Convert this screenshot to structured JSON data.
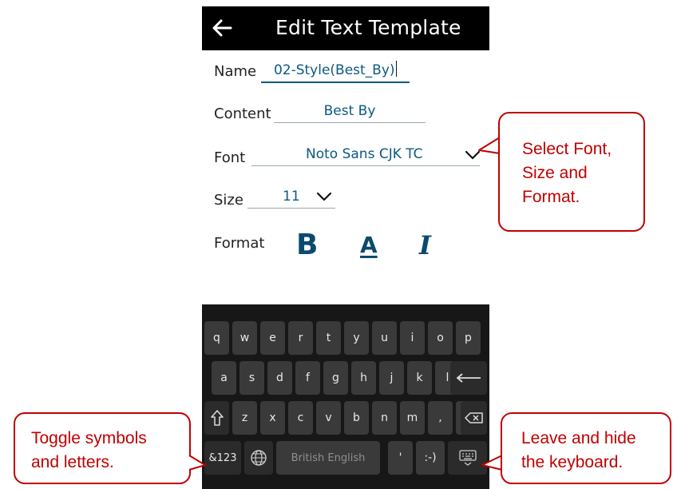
{
  "header": {
    "title": "Edit Text Template",
    "back_icon": "back-arrow-icon"
  },
  "form": {
    "name_label": "Name",
    "name_value": "02-Style(Best_By)",
    "content_label": "Content",
    "content_value": "Best By",
    "font_label": "Font",
    "font_value": "Noto Sans CJK TC",
    "size_label": "Size",
    "size_value": "11",
    "format_label": "Format",
    "format_bold": "B",
    "format_underline": "A",
    "format_italic": "I"
  },
  "keyboard": {
    "row1": [
      "q",
      "w",
      "e",
      "r",
      "t",
      "y",
      "u",
      "i",
      "o",
      "p"
    ],
    "row2": [
      "a",
      "s",
      "d",
      "f",
      "g",
      "h",
      "j",
      "k",
      "l"
    ],
    "row3": [
      "z",
      "x",
      "c",
      "v",
      "b",
      "n",
      "m",
      ",",
      "."
    ],
    "symbols_key": "&123",
    "space_label": "British English",
    "apostrophe": "'",
    "emoji_key": ":-)"
  },
  "callouts": {
    "font": [
      "Select Font,",
      "Size and",
      "Format."
    ],
    "symbols": [
      "Toggle symbols",
      "and letters."
    ],
    "hide": [
      "Leave and hide",
      "the keyboard."
    ]
  },
  "colors": {
    "accent": "#0b5a80",
    "callout": "#c00000",
    "keyboard_bg": "#171717",
    "key_bg": "#3a3a3a"
  }
}
